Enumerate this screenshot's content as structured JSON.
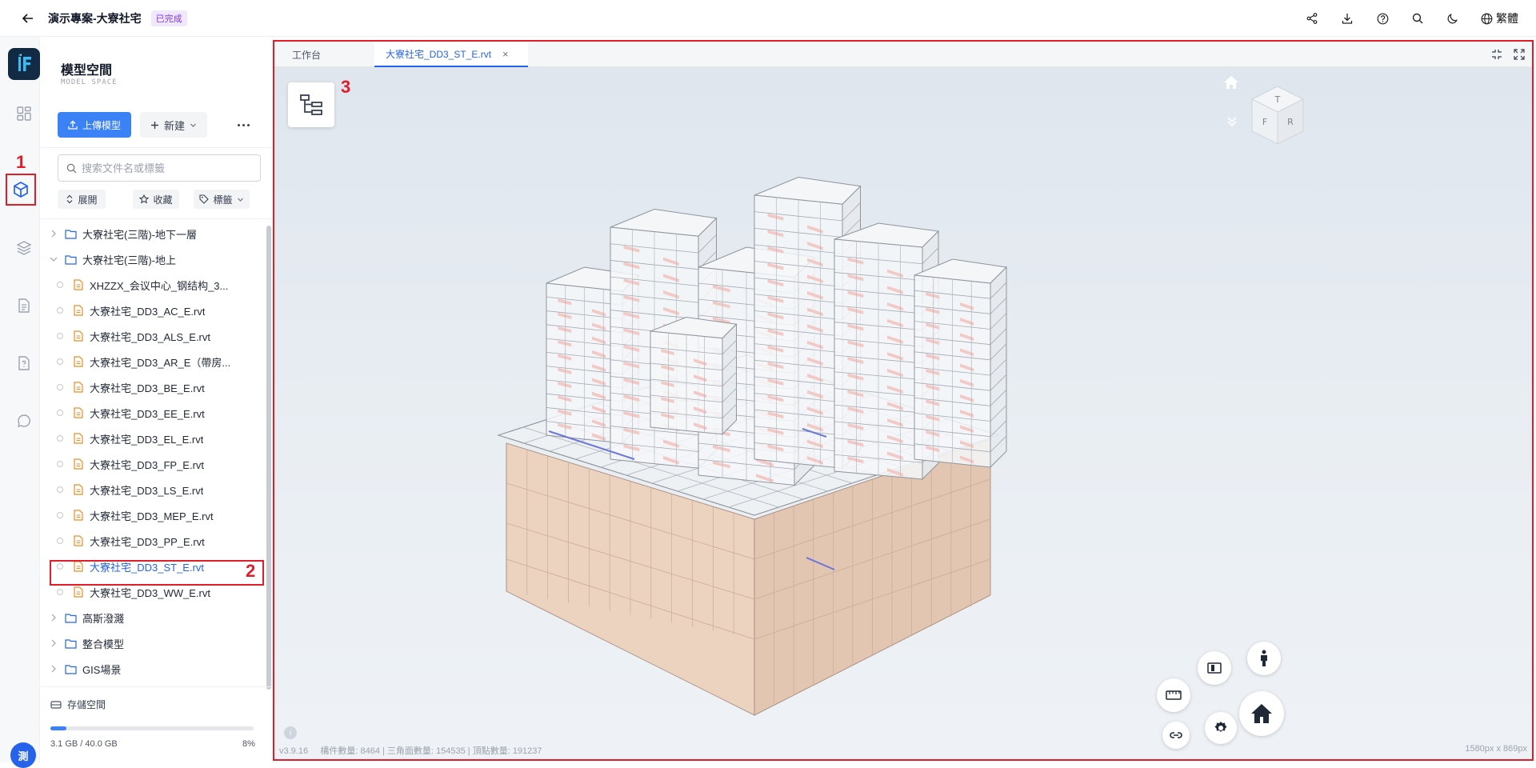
{
  "topbar": {
    "title": "演示專案-大寮社宅",
    "status": "已完成",
    "lang": "繁體"
  },
  "rail": {
    "avatar": "測",
    "marker": "1"
  },
  "panel": {
    "title": "模型空間",
    "subtitle": "MODEL SPACE",
    "upload_label": "上傳模型",
    "new_label": "新建",
    "search_placeholder": "搜索文件名或標籤",
    "chips": {
      "expand": "展開",
      "favorite": "收藏",
      "tags": "標籤"
    },
    "tree": [
      {
        "type": "folder",
        "label": "大寮社宅(三階)-地下一層",
        "state": "collapsed"
      },
      {
        "type": "folder",
        "label": "大寮社宅(三階)-地上",
        "state": "expanded"
      },
      {
        "type": "file",
        "label": "XHZZX_会议中心_钢结构_3..."
      },
      {
        "type": "file",
        "label": "大寮社宅_DD3_AC_E.rvt"
      },
      {
        "type": "file",
        "label": "大寮社宅_DD3_ALS_E.rvt"
      },
      {
        "type": "file",
        "label": "大寮社宅_DD3_AR_E（帶房..."
      },
      {
        "type": "file",
        "label": "大寮社宅_DD3_BE_E.rvt"
      },
      {
        "type": "file",
        "label": "大寮社宅_DD3_EE_E.rvt"
      },
      {
        "type": "file",
        "label": "大寮社宅_DD3_EL_E.rvt"
      },
      {
        "type": "file",
        "label": "大寮社宅_DD3_FP_E.rvt"
      },
      {
        "type": "file",
        "label": "大寮社宅_DD3_LS_E.rvt"
      },
      {
        "type": "file",
        "label": "大寮社宅_DD3_MEP_E.rvt"
      },
      {
        "type": "file",
        "label": "大寮社宅_DD3_PP_E.rvt"
      },
      {
        "type": "file",
        "label": "大寮社宅_DD3_ST_E.rvt",
        "selected": true
      },
      {
        "type": "file",
        "label": "大寮社宅_DD3_WW_E.rvt"
      },
      {
        "type": "folder",
        "label": "高斯潑濺",
        "state": "collapsed"
      },
      {
        "type": "folder",
        "label": "整合模型",
        "state": "collapsed"
      },
      {
        "type": "folder",
        "label": "GIS場景",
        "state": "collapsed"
      }
    ],
    "selected_marker": "2",
    "storage": {
      "label": "存儲空間",
      "used": "3.1 GB / 40.0 GB",
      "percent_label": "8%",
      "fraction": 0.08
    }
  },
  "viewer": {
    "tabs": [
      {
        "label": "工作台",
        "active": false
      },
      {
        "label": "大寮社宅_DD3_ST_E.rvt",
        "active": true
      }
    ],
    "tab_close": "×",
    "marker": "3",
    "cube_faces": {
      "top": "T",
      "front": "F",
      "right": "R"
    },
    "footer": {
      "version": "v3.9.16",
      "stats": "構件數量: 8464 | 三角面數量: 154535 | 頂點數量: 191237",
      "resolution": "1580px x 869px"
    }
  },
  "colors": {
    "accent": "#3b82f6",
    "annotation": "#e11d2a",
    "badge": "#7c3aed"
  },
  "icons": [
    "back-arrow-icon",
    "share-icon",
    "download-icon",
    "help-icon",
    "search-icon",
    "moon-icon",
    "globe-icon",
    "dashboard-icon",
    "cube-icon",
    "layers-icon",
    "document-icon",
    "file-question-icon",
    "chat-icon",
    "upload-icon",
    "plus-icon",
    "chevron-down-icon",
    "more-icon",
    "tag-icon",
    "star-icon",
    "sort-icon",
    "folder-icon",
    "file-icon",
    "database-icon",
    "model-tree-icon",
    "home-icon",
    "view-cube-icon",
    "fullscreen-icon",
    "split-icon",
    "person-icon",
    "measure-icon",
    "settings-icon",
    "link-icon"
  ]
}
